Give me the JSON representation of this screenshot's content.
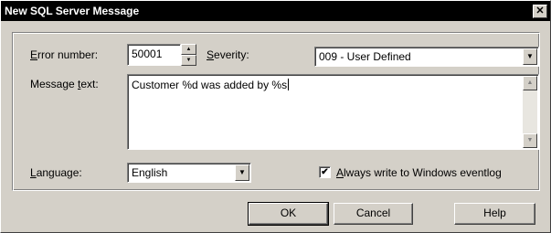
{
  "window": {
    "title": "New SQL Server Message",
    "close_glyph": "✕"
  },
  "form": {
    "error_number": {
      "label_accel": "E",
      "label_rest": "rror number:",
      "value": "50001"
    },
    "severity": {
      "label_accel": "S",
      "label_rest": "everity:",
      "value": "009 - User Defined"
    },
    "message_text": {
      "label_pre": "Message ",
      "label_accel": "t",
      "label_rest": "ext:",
      "value": "Customer %d was added by %s"
    },
    "language": {
      "label_accel": "L",
      "label_rest": "anguage:",
      "value": "English"
    },
    "eventlog": {
      "checked": true,
      "label_accel": "A",
      "label_rest": "lways write to Windows eventlog"
    }
  },
  "buttons": {
    "ok": "OK",
    "cancel": "Cancel",
    "help": "Help"
  },
  "icons": {
    "dropdown": "▼",
    "spin_up": "▲",
    "spin_down": "▼",
    "scroll_up": "▲",
    "scroll_down": "▼",
    "check": "✔"
  }
}
